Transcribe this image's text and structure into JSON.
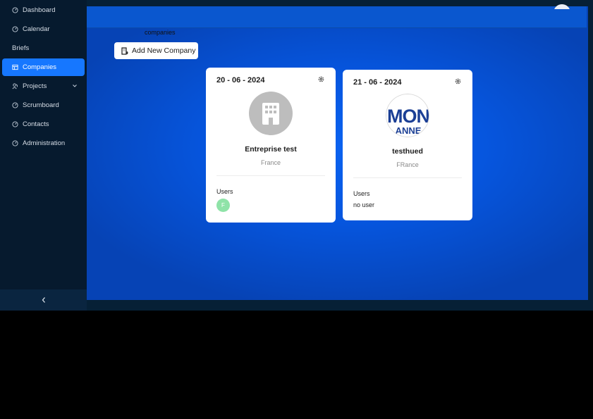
{
  "sidebar": {
    "items": [
      {
        "label": "Dashboard",
        "icon": "dashboard-icon"
      },
      {
        "label": "Calendar",
        "icon": "calendar-icon"
      },
      {
        "label": "Briefs",
        "icon": ""
      },
      {
        "label": "Companies",
        "icon": "companies-icon",
        "active": true
      },
      {
        "label": "Projects",
        "icon": "projects-icon",
        "expandable": true
      },
      {
        "label": "Scrumboard",
        "icon": "scrumboard-icon"
      },
      {
        "label": "Contacts",
        "icon": "contacts-icon"
      },
      {
        "label": "Administration",
        "icon": "administration-icon"
      }
    ],
    "collapse_icon": "chevron-left-icon"
  },
  "main": {
    "breadcrumb": "companies",
    "add_button_label": "Add New Company",
    "cards": [
      {
        "date": "20 - 06 - 2024",
        "name": "Entreprise test",
        "country": "France",
        "users_label": "Users",
        "users": [
          "F"
        ],
        "logo": "building-icon"
      },
      {
        "date": "21 - 06 - 2024",
        "name": "testhued",
        "country": "FRance",
        "users_label": "Users",
        "no_user_text": "no user",
        "logo_text_top": "MON",
        "logo_text_bottom": "ANNE"
      }
    ]
  },
  "colors": {
    "accent": "#1677ff",
    "sidebar_bg": "#061a2e",
    "main_bg": "#0656df",
    "user_badge": "#8fe3a8"
  }
}
